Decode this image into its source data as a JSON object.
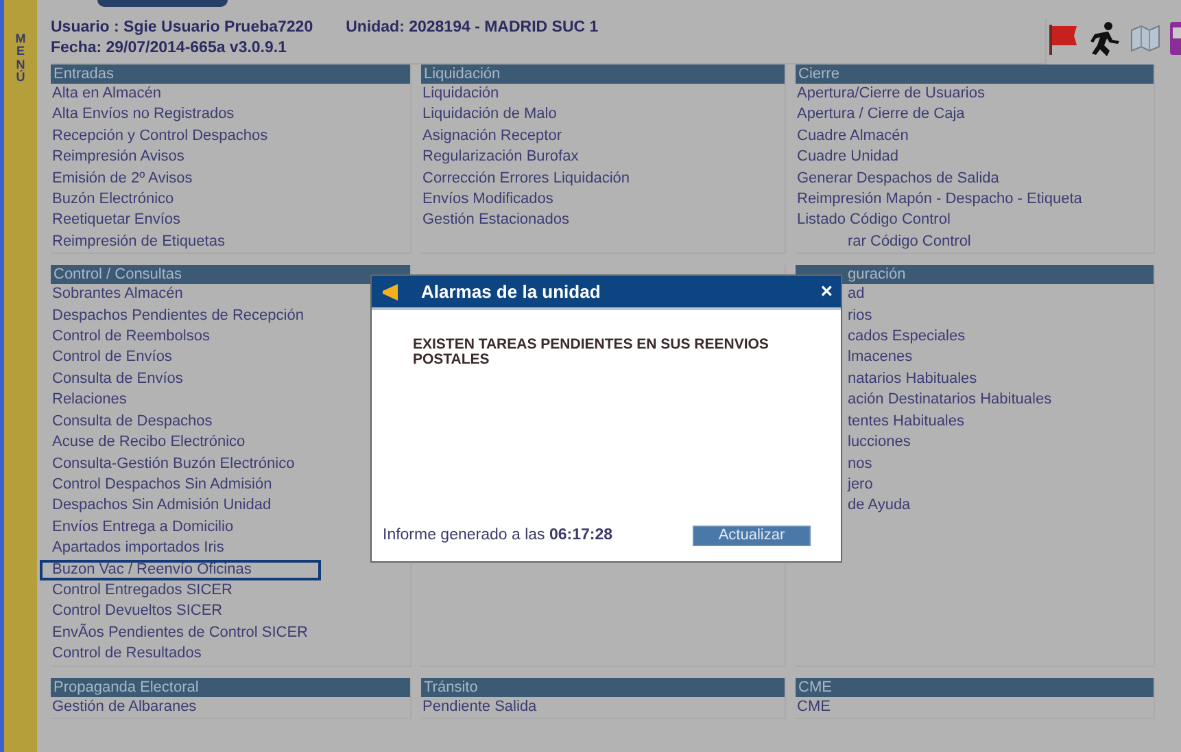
{
  "side_menu": {
    "label": "MENÚ"
  },
  "header": {
    "user": "Usuario : Sgie Usuario Prueba7220",
    "unit": "Unidad: 2028194 - MADRID SUC 1",
    "date": "Fecha: 29/07/2014-665a v3.0.9.1"
  },
  "rows": [
    [
      {
        "title": "Entradas",
        "title_covered": false,
        "items": [
          {
            "text": "Alta en Almacén",
            "kind": "link"
          },
          {
            "text": "Alta Envíos no Registrados",
            "kind": "link"
          },
          {
            "text": "Recepción y Control Despachos",
            "kind": "link"
          },
          {
            "text": "Reimpresión Avisos",
            "kind": "link"
          },
          {
            "text": "Emisión de 2º Avisos",
            "kind": "link"
          },
          {
            "text": "Buzón Electrónico",
            "kind": "link"
          },
          {
            "text": "Reetiquetar Envíos",
            "kind": "link"
          },
          {
            "text": "Reimpresión de Etiquetas",
            "kind": "link"
          }
        ]
      },
      {
        "title": "Liquidación",
        "title_covered": false,
        "items": [
          {
            "text": "Liquidación",
            "kind": "link"
          },
          {
            "text": "Liquidación de Malo",
            "kind": "link"
          },
          {
            "text": "Asignación Receptor",
            "kind": "link"
          },
          {
            "text": "Regularización Burofax",
            "kind": "link"
          },
          {
            "text": "Corrección Errores Liquidación",
            "kind": "link"
          },
          {
            "text": "Envíos Modificados",
            "kind": "link"
          },
          {
            "text": "Gestión Estacionados",
            "kind": "link"
          }
        ]
      },
      {
        "title": "Cierre",
        "title_covered": false,
        "items": [
          {
            "text": "Apertura/Cierre de Usuarios",
            "kind": "link"
          },
          {
            "text": "Apertura / Cierre de Caja",
            "kind": "link"
          },
          {
            "text": "Cuadre Almacén",
            "kind": "link"
          },
          {
            "text": "Cuadre Unidad",
            "kind": "link"
          },
          {
            "text": "Generar Despachos de Salida",
            "kind": "link"
          },
          {
            "text": "Reimpresión Mapón - Despacho - Etiqueta",
            "kind": "link"
          },
          {
            "text": "Listado Código Control",
            "kind": "link"
          },
          {
            "text": "rar Código Control",
            "kind": "covered"
          }
        ]
      }
    ],
    [
      {
        "title": "Control / Consultas",
        "title_covered": false,
        "items": [
          {
            "text": "Sobrantes Almacén",
            "kind": "link"
          },
          {
            "text": "Despachos Pendientes de Recepción",
            "kind": "link"
          },
          {
            "text": "Control de Reembolsos",
            "kind": "link"
          },
          {
            "text": "Control de Envíos",
            "kind": "link"
          },
          {
            "text": "Consulta de Envíos",
            "kind": "link"
          },
          {
            "text": "Relaciones",
            "kind": "link"
          },
          {
            "text": "Consulta de Despachos",
            "kind": "link"
          },
          {
            "text": "Acuse de Recibo Electrónico",
            "kind": "link"
          },
          {
            "text": "Consulta-Gestión Buzón Electrónico",
            "kind": "link"
          },
          {
            "text": "Control Despachos Sin Admisión",
            "kind": "link"
          },
          {
            "text": "Despachos Sin Admisión Unidad",
            "kind": "link"
          },
          {
            "text": "Envíos Entrega a Domicilio",
            "kind": "link"
          },
          {
            "text": "Apartados importados Iris",
            "kind": "link"
          },
          {
            "text": "Buzon Vac / Reenvío Oficinas",
            "kind": "highlighted"
          },
          {
            "text": "Control Entregados SICER",
            "kind": "link"
          },
          {
            "text": "Control Devueltos SICER",
            "kind": "link"
          },
          {
            "text": "EnvÃos Pendientes de Control SICER",
            "kind": "link"
          },
          {
            "text": "Control de Resultados",
            "kind": "link"
          }
        ]
      },
      {
        "kind": "hidden"
      },
      {
        "title": "guración",
        "title_covered": true,
        "items": [
          {
            "text": "ad",
            "kind": "covered"
          },
          {
            "text": "rios",
            "kind": "covered"
          },
          {
            "text": "cados Especiales",
            "kind": "covered"
          },
          {
            "text": "lmacenes",
            "kind": "covered"
          },
          {
            "text": "natarios Habituales",
            "kind": "covered"
          },
          {
            "text": "ación Destinatarios Habituales",
            "kind": "covered"
          },
          {
            "text": "tentes Habituales",
            "kind": "covered"
          },
          {
            "text": "lucciones",
            "kind": "covered"
          },
          {
            "text": "nos",
            "kind": "covered"
          },
          {
            "text": "jero",
            "kind": "covered"
          },
          {
            "text": "de Ayuda",
            "kind": "covered"
          }
        ]
      }
    ],
    [
      {
        "title": "Propaganda Electoral",
        "title_covered": false,
        "items": [
          {
            "text": "Gestión de Albaranes",
            "kind": "link"
          }
        ]
      },
      {
        "title": "Tránsito",
        "title_covered": false,
        "items": [
          {
            "text": "Pendiente Salida",
            "kind": "link"
          }
        ]
      },
      {
        "title": "CME",
        "title_covered": false,
        "items": [
          {
            "text": "CME",
            "kind": "link"
          }
        ]
      }
    ]
  ],
  "dialog": {
    "title": "Alarmas de la unidad",
    "close": "×",
    "message": "EXISTEN TAREAS PENDIENTES EN SUS REENVIOS POSTALES",
    "footer": "Informe generado a las **06:17:28**",
    "button": "Actualizar"
  }
}
